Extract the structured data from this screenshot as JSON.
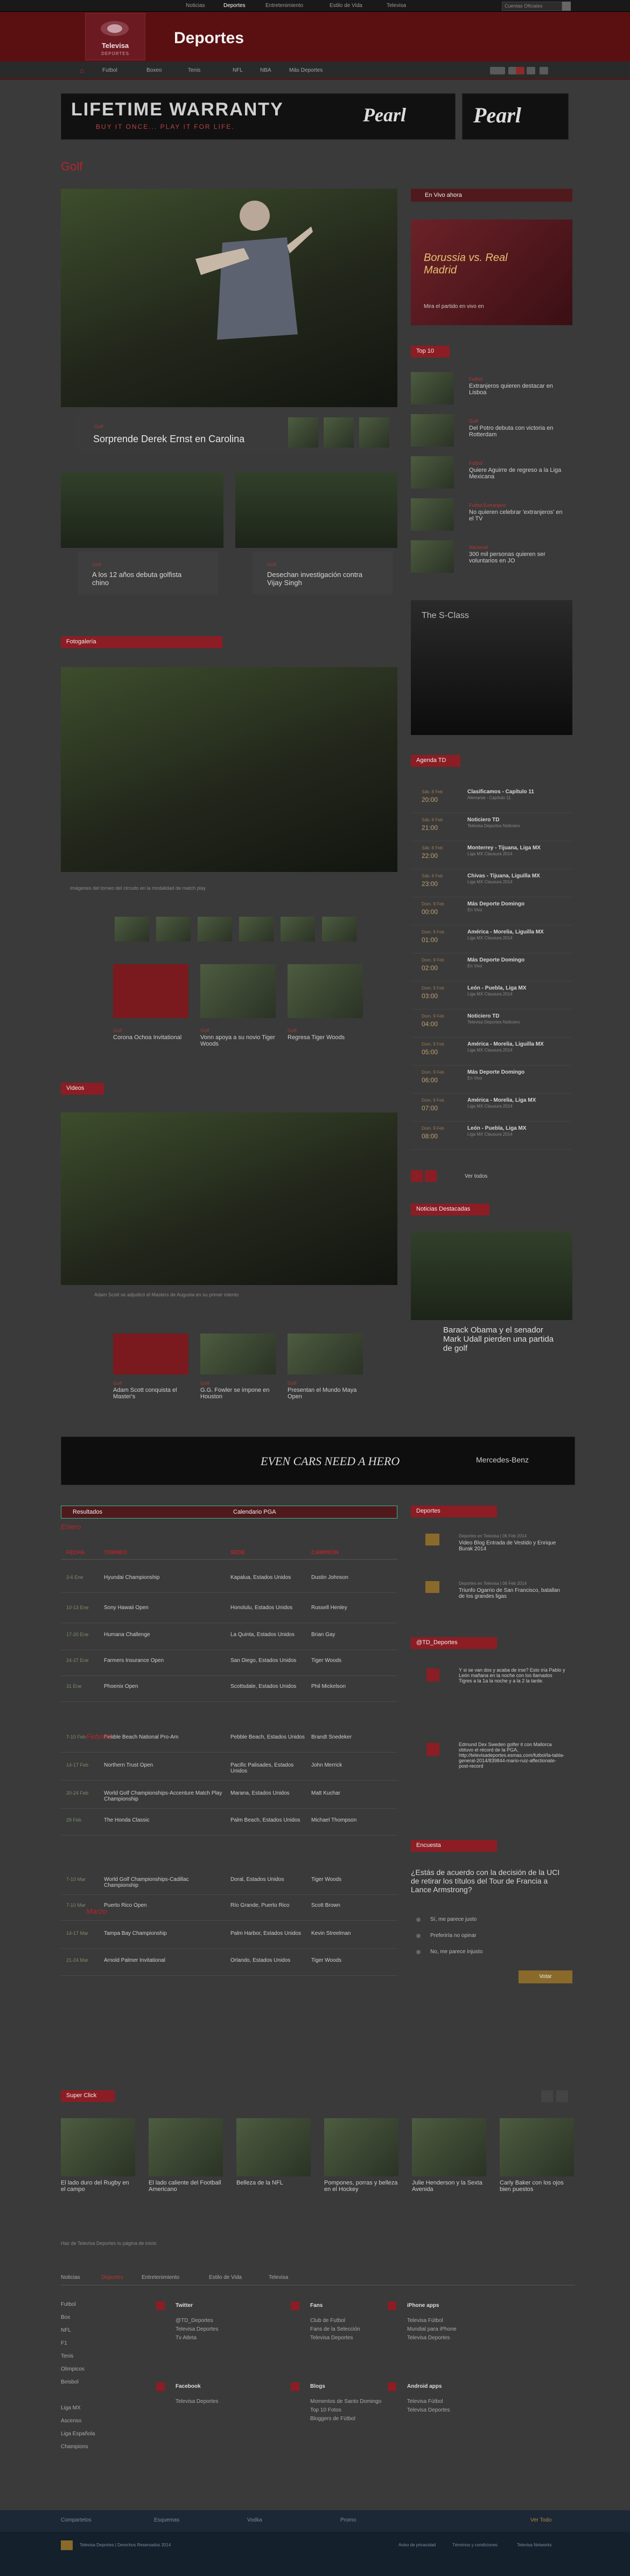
{
  "topnav": {
    "links": [
      "Noticias",
      "Deportes",
      "Entretenimiento",
      "Estilo de Vida",
      "Televisa"
    ],
    "search_placeholder": "Buscar en Televisa...",
    "search_value": "Cuentas Oficiales"
  },
  "header": {
    "logo_text": "Televisa",
    "logo_sub": "DEPORTES",
    "site_name": "Deportes"
  },
  "mainnav": {
    "items": [
      "Futbol",
      "Boxeo",
      "Tenis",
      "NFL",
      "NBA",
      "Más Deportes"
    ],
    "home_label": "Inicio"
  },
  "banner": {
    "line1": "LIFETIME WARRANTY",
    "line2": "BUY IT ONCE... PLAY IT FOR LIFE.",
    "brand": "Pearl",
    "brand2": "Pearl"
  },
  "section_title": "Golf",
  "hero": {
    "category": "Golf",
    "title": "Sorprende Derek Ernst en Carolina"
  },
  "cards": [
    {
      "category": "Golf",
      "title": "A los 12 años debuta golfista chino"
    },
    {
      "category": "Golf",
      "title": "Desechan investigación contra Vijay Singh"
    }
  ],
  "fotogaleria": {
    "label": "Fotogalería",
    "caption": "Imágenes del torneo del circuito en la modalidad de match play",
    "thumbs": [
      {
        "category": "Golf",
        "title": "Corona Ochoa Invitational"
      },
      {
        "category": "Golf",
        "title": "Vonn apoya a su novio Tiger Woods"
      },
      {
        "category": "Golf",
        "title": "Regresa Tiger Woods"
      }
    ]
  },
  "videos": {
    "label": "Videos",
    "caption": "Adam Scott se adjudicó el Masters de Augusta en su primer intento",
    "thumbs": [
      {
        "category": "Golf",
        "title": "Adam Scott conquista el Master's"
      },
      {
        "category": "Golf",
        "title": "G.G. Fowler se impone en Houston"
      },
      {
        "category": "Golf",
        "title": "Presentan el Mundo Maya Open"
      }
    ]
  },
  "ad2": {
    "text": "EVEN CARS NEED A HERO",
    "brand": "Mercedes-Benz"
  },
  "calendar": {
    "tabs": [
      "Resultados",
      "Calendario PGA"
    ],
    "month1": "Enero",
    "month2": "Febrero",
    "month3": "Marzo",
    "headers": [
      "FECHA",
      "TORNEO",
      "SEDE",
      "CAMPEÓN"
    ],
    "rows": [
      {
        "date": "3-6 Ene",
        "t": "Hyundai Championship",
        "s": "Kapalua, Estados Unidos",
        "c": "Dustin Johnson"
      },
      {
        "date": "10-13 Ene",
        "t": "Sony Hawaii Open",
        "s": "Honolulu, Estados Unidos",
        "c": "Russell Henley"
      },
      {
        "date": "17-20 Ene",
        "t": "Humana Challenge",
        "s": "La Quinta, Estados Unidos",
        "c": "Brian Gay"
      },
      {
        "date": "24-27 Ene",
        "t": "Farmers Insurance Open",
        "s": "San Diego, Estados Unidos",
        "c": "Tiger Woods"
      },
      {
        "date": "31 Ene",
        "t": "Phoenix Open",
        "s": "Scottsdale, Estados Unidos",
        "c": "Phil Mickelson"
      },
      {
        "date": "7-10 Feb",
        "t": "Pebble Beach National Pro-Am",
        "s": "Pebble Beach, Estados Unidos",
        "c": "Brandt Snedeker"
      },
      {
        "date": "14-17 Feb",
        "t": "Northern Trust Open",
        "s": "Pacific Palisades, Estados Unidos",
        "c": "John Merrick"
      },
      {
        "date": "20-24 Feb",
        "t": "World Golf Championships-Accenture Match Play Championship",
        "s": "Marana, Estados Unidos",
        "c": "Matt Kuchar"
      },
      {
        "date": "28 Feb",
        "t": "The Honda Classic",
        "s": "Palm Beach, Estados Unidos",
        "c": "Michael Thompson"
      },
      {
        "date": "7-10 Mar",
        "t": "World Golf Championships-Cadillac Championship",
        "s": "Doral, Estados Unidos",
        "c": "Tiger Woods"
      },
      {
        "date": "7-10 Mar",
        "t": "Puerto Rico Open",
        "s": "Río Grande, Puerto Rico",
        "c": "Scott Brown"
      },
      {
        "date": "14-17 Mar",
        "t": "Tampa Bay Championship",
        "s": "Palm Harbor, Estados Unidos",
        "c": "Kevin Streelman"
      },
      {
        "date": "21-24 Mar",
        "t": "Arnold Palmer Invitational",
        "s": "Orlando, Estados Unidos",
        "c": "Tiger Woods"
      }
    ]
  },
  "sidebar": {
    "envivo": "En Vivo ahora",
    "promo": "Borussia vs. Real Madrid",
    "promo_sub": "Mira el partido en vivo en",
    "top10": "Top 10",
    "top": [
      {
        "cat": "Futbol",
        "tit": "Extranjeros quieren destacar en Lisboa"
      },
      {
        "cat": "Golf",
        "tit": "Del Potro debuta con victoria en Rotterdam"
      },
      {
        "cat": "Futbol",
        "tit": "Quiere Aguirre de regreso a la Liga Mexicana"
      },
      {
        "cat": "Futbol Extranjero",
        "tit": "No quieren celebrar 'extranjeros' en el TV"
      },
      {
        "cat": "Nacional",
        "tit": "300 mil personas quieren ser voluntarios en JO"
      }
    ],
    "ad": "The S-Class",
    "agenda": "Agenda TD",
    "agenda_rows": [
      {
        "d": "Sáb. 8 Feb",
        "h": "20:00",
        "p": "Clasificamos - Capítulo 11",
        "s": "Alemania - Capítulo 11"
      },
      {
        "d": "Sáb. 8 Feb",
        "h": "21:00",
        "p": "Noticiero TD",
        "s": "Televisa Deportes Noticiero"
      },
      {
        "d": "Sáb. 8 Feb",
        "h": "22:00",
        "p": "Monterrey - Tijuana, Liga MX",
        "s": "Liga MX Clausura 2014"
      },
      {
        "d": "Sáb. 8 Feb",
        "h": "23:00",
        "p": "Chivas - Tijuana, Liguilla MX",
        "s": "Liga MX Clausura 2014"
      },
      {
        "d": "Dom. 9 Feb",
        "h": "00:00",
        "p": "Más Deporte Domingo",
        "s": "En Vivo"
      },
      {
        "d": "Dom. 9 Feb",
        "h": "01:00",
        "p": "América - Morelia, Liguilla MX",
        "s": "Liga MX Clausura 2014"
      },
      {
        "d": "Dom. 9 Feb",
        "h": "02:00",
        "p": "Más Deporte Domingo",
        "s": "En Vivo"
      },
      {
        "d": "Dom. 9 Feb",
        "h": "03:00",
        "p": "León - Puebla, Liga MX",
        "s": "Liga MX Clausura 2014"
      },
      {
        "d": "Dom. 9 Feb",
        "h": "04:00",
        "p": "Noticiero TD",
        "s": "Televisa Deportes Noticiero"
      },
      {
        "d": "Dom. 9 Feb",
        "h": "05:00",
        "p": "América - Morelia, Liguilla MX",
        "s": "Liga MX Clausura 2014"
      },
      {
        "d": "Dom. 9 Feb",
        "h": "06:00",
        "p": "Más Deporte Domingo",
        "s": "En Vivo"
      },
      {
        "d": "Dom. 9 Feb",
        "h": "07:00",
        "p": "América - Morelia, Liga MX",
        "s": "Liga MX Clausura 2014"
      },
      {
        "d": "Dom. 9 Feb",
        "h": "08:00",
        "p": "León - Puebla, Liga MX",
        "s": "Liga MX Clausura 2014"
      }
    ],
    "ver_todos": "Ver todos",
    "noticias": "Noticias Destacadas",
    "noticias_title": "Barack Obama y el senador Mark Udall pierden una partida de golf",
    "deportes": "Deportes",
    "dep_items": [
      {
        "meta": "Deportes en Televisa | 06 Feb 2014",
        "tit": "Video Blog Entrada de Vestido y Enrique Burak 2014"
      },
      {
        "meta": "Deportes en Televisa | 06 Feb 2014",
        "tit": "Triunfo Ogarrio de San Francisco, batallan de los grandes ligas"
      }
    ],
    "twitter": "@TD_Deportes",
    "tweets": [
      "Y si se van dos y acaba de irse? Esto iría Pablo y León mañana en la noche con los llamados Tigres a la 1a la noche y a la 2 la tarde.",
      "Edmund Dex Sweden golfer it con Mallorca obtuvo el récord de la PGA, http://televisadeportes.esmas.com/futbol/la-tabla-general-2014/839844-mario-ruiz-affectionate-post-record"
    ],
    "encuesta": "Encuesta",
    "q": "¿Estás de acuerdo con la decisión de la UCI de retirar los títulos del Tour de Francia a Lance Armstrong?",
    "opts": [
      "Sí, me parece justo",
      "Preferiría no opinar",
      "No, me parece injusto"
    ],
    "vote": "Votar"
  },
  "superclick": {
    "label": "Super Click",
    "items": [
      "El lado duro del Rugby en el campo",
      "El lado caliente del Football Americano",
      "Belleza de la NFL",
      "Pompones, porras y belleza en el Hockey",
      "Julie Henderson y la Sexta Avenida",
      "Carly Baker con los ojos bien puestos"
    ]
  },
  "footer": {
    "add": "Haz de Televisa Deportes tu página de inicio",
    "tabs": [
      "Noticias",
      "Deportes",
      "Entretenimiento",
      "Estilo de Vida",
      "Televisa"
    ],
    "leftlinks": [
      "Futbol",
      "Box",
      "NFL",
      "F1",
      "Tenis",
      "Olimpicos",
      "Beisbol",
      "",
      "Liga MX",
      "Ascenso",
      "Liga Española",
      "Champions"
    ],
    "groups": [
      {
        "t": "Twitter",
        "l": [
          "@TD_Deportes",
          "Televisa Deportes",
          "Tv Atleta"
        ]
      },
      {
        "t": "Fans",
        "l": [
          "Club de Futbol",
          "Fans de la Selección",
          "Televisa Deportes"
        ]
      },
      {
        "t": "iPhone apps",
        "l": [
          "Televisa Fútbol",
          "Mundial para iPhone",
          "Televisa Deportes"
        ]
      },
      {
        "t": "Facebook",
        "l": [
          "Televisa Deportes"
        ]
      },
      {
        "t": "Blogs",
        "l": [
          "Momentos de Santo Domingo",
          "Top 10 Fotos",
          "Bloggers de Fútbol"
        ]
      },
      {
        "t": "Android apps",
        "l": [
          "Televisa Fútbol",
          "Televisa Deportes"
        ]
      }
    ],
    "bottom": [
      "Compartelos",
      "Esquemas",
      "Vodka",
      "Promo",
      "Ver Todo"
    ],
    "copyright": "Televisa Deportes | Derechos Reservados 2014",
    "legal": [
      "Aviso de privacidad",
      "Términos y condiciones",
      "Televisa Networks"
    ]
  }
}
